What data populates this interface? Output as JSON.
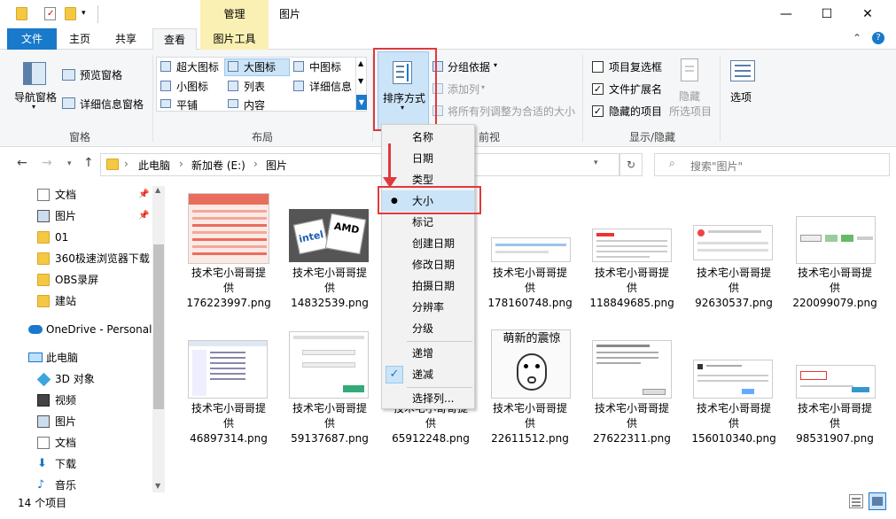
{
  "titlebar": {
    "context_tab": "管理",
    "title": "图片",
    "minimize": "—",
    "maximize": "☐",
    "close": "✕"
  },
  "tabs": {
    "file": "文件",
    "home": "主页",
    "share": "共享",
    "view": "查看",
    "picture_tools": "图片工具",
    "up_arrow": "⌃",
    "help": "?"
  },
  "ribbon": {
    "panes": {
      "nav_pane": "导航窗格",
      "preview": "预览窗格",
      "details": "详细信息窗格",
      "label": "窗格"
    },
    "layout": {
      "extra_large": "超大图标",
      "large": "大图标",
      "medium": "中图标",
      "small": "小图标",
      "list": "列表",
      "details": "详细信息",
      "tiles": "平铺",
      "content": "内容",
      "label": "布局"
    },
    "current_view": {
      "sort_by": "排序方式",
      "group_by": "分组依据",
      "add_columns": "添加列",
      "size_all": "将所有列调整为合适的大小",
      "label_partial": "前视图"
    },
    "show_hide": {
      "item_checkbox": "项目复选框",
      "file_ext": "文件扩展名",
      "hidden_items": "隐藏的项目",
      "hide": "隐藏",
      "selected_items": "所选项目",
      "options": "选项",
      "label": "显示/隐藏"
    }
  },
  "address": {
    "breadcrumb": [
      "此电脑",
      "新加卷 (E:)",
      "图片"
    ],
    "separator": "›",
    "search_placeholder": "搜索\"图片\""
  },
  "nav": {
    "items": [
      {
        "label": "文档",
        "pinned": true
      },
      {
        "label": "图片",
        "pinned": true
      },
      {
        "label": "01"
      },
      {
        "label": "360极速浏览器下载"
      },
      {
        "label": "OBS录屏"
      },
      {
        "label": "建站"
      },
      {
        "label": "OneDrive - Personal"
      },
      {
        "label": "此电脑"
      },
      {
        "label": "3D 对象"
      },
      {
        "label": "视频"
      },
      {
        "label": "图片"
      },
      {
        "label": "文档"
      },
      {
        "label": "下载"
      },
      {
        "label": "音乐"
      }
    ]
  },
  "files": {
    "row1": [
      {
        "l1": "技术宅小哥哥提",
        "l2": "供",
        "l3": "176223997.png"
      },
      {
        "l1": "技术宅小哥哥提",
        "l2": "供",
        "l3": "14832539.png"
      },
      {
        "l1": "技术宅小哥哥提",
        "l2": "供",
        "l3": "178160748.png"
      },
      {
        "l1": "技术宅小哥哥提",
        "l2": "供",
        "l3": "118849685.png"
      },
      {
        "l1": "技术宅小哥哥提",
        "l2": "供",
        "l3": "92630537.png"
      },
      {
        "l1": "技术宅小哥哥提",
        "l2": "供",
        "l3": "220099079.png"
      }
    ],
    "row2": [
      {
        "l1": "技术宅小哥哥提",
        "l2": "供",
        "l3": "46897314.png"
      },
      {
        "l1": "技术宅小哥哥提",
        "l2": "供",
        "l3": "59137687.png"
      },
      {
        "l1": "技术宅小哥哥提",
        "l2": "供",
        "l3": "65912248.png"
      },
      {
        "l1": "技术宅小哥哥提",
        "l2": "供",
        "l3": "22611512.png"
      },
      {
        "l1": "技术宅小哥哥提",
        "l2": "供",
        "l3": "27622311.png"
      },
      {
        "l1": "技术宅小哥哥提",
        "l2": "供",
        "l3": "156010340.png"
      },
      {
        "l1": "技术宅小哥哥提",
        "l2": "供",
        "l3": "98531907.png"
      }
    ],
    "thumb_text": {
      "amd": "AMD",
      "intel": "intel",
      "meme": "萌新的震惊"
    }
  },
  "sort_menu": {
    "items": [
      "名称",
      "日期",
      "类型",
      "大小",
      "标记",
      "创建日期",
      "修改日期",
      "拍摄日期",
      "分辨率",
      "分级"
    ],
    "selected": "大小",
    "bullet": "●",
    "order": [
      "递增",
      "递减"
    ],
    "checked_order": "递减",
    "check": "✓",
    "choose_columns": "选择列..."
  },
  "status": {
    "count": "14 个项目"
  },
  "colors": {
    "accent": "#1979ca",
    "context_tab": "#fbf0b3",
    "highlight": "#e0393e"
  }
}
